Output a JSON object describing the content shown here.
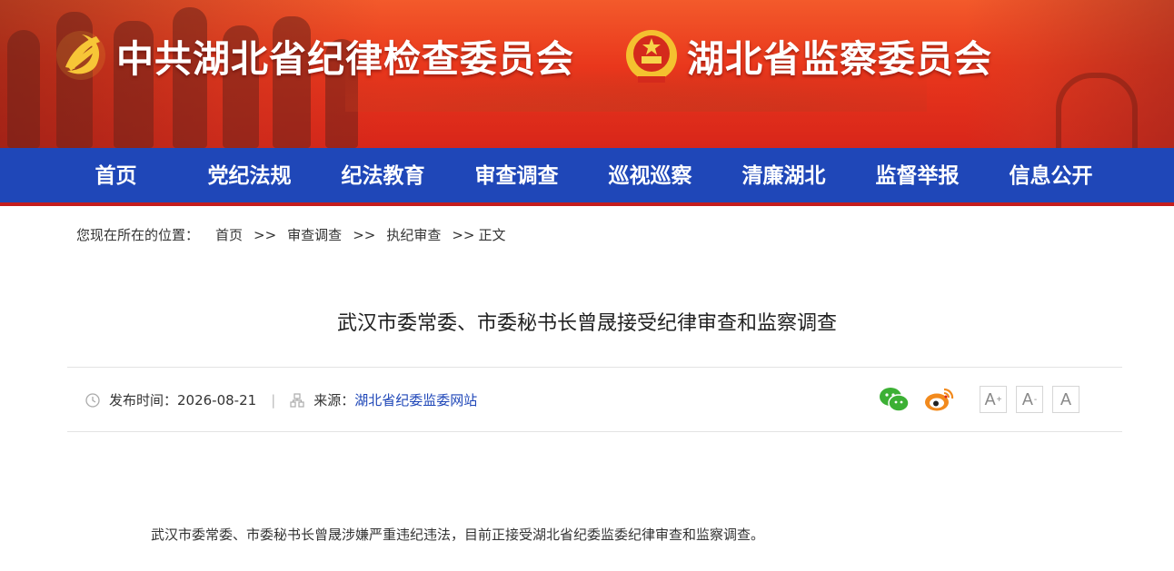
{
  "header": {
    "org1": "中共湖北省纪律检查委员会",
    "org2": "湖北省监察委员会"
  },
  "nav": {
    "items": [
      "首页",
      "党纪法规",
      "纪法教育",
      "审查调查",
      "巡视巡察",
      "清廉湖北",
      "监督举报",
      "信息公开"
    ]
  },
  "breadcrumb": {
    "prefix": "您现在所在的位置：",
    "items": [
      "首页",
      "审查调查",
      "执纪审查",
      "正文"
    ],
    "separator": ">>"
  },
  "article": {
    "title": "武汉市委常委、市委秘书长曾晟接受纪律审查和监察调查",
    "publish_label": "发布时间：2026-08-21",
    "source_label": "来源：",
    "source_value": "湖北省纪委监委网站",
    "divider": "|",
    "body": "武汉市委常委、市委秘书长曾晟涉嫌严重违纪违法，目前正接受湖北省纪委监委纪律审查和监察调查。"
  },
  "share": {
    "icons": [
      "wechat-icon",
      "weibo-icon"
    ]
  },
  "font_size": {
    "large": "A",
    "large_sup": "+",
    "medium": "A",
    "medium_sup": "-",
    "normal": "A"
  },
  "colors": {
    "banner_red": "#e9371c",
    "nav_blue": "#1f47b8",
    "nav_border_red": "#c41d1d",
    "source_blue": "#1f47b8"
  }
}
